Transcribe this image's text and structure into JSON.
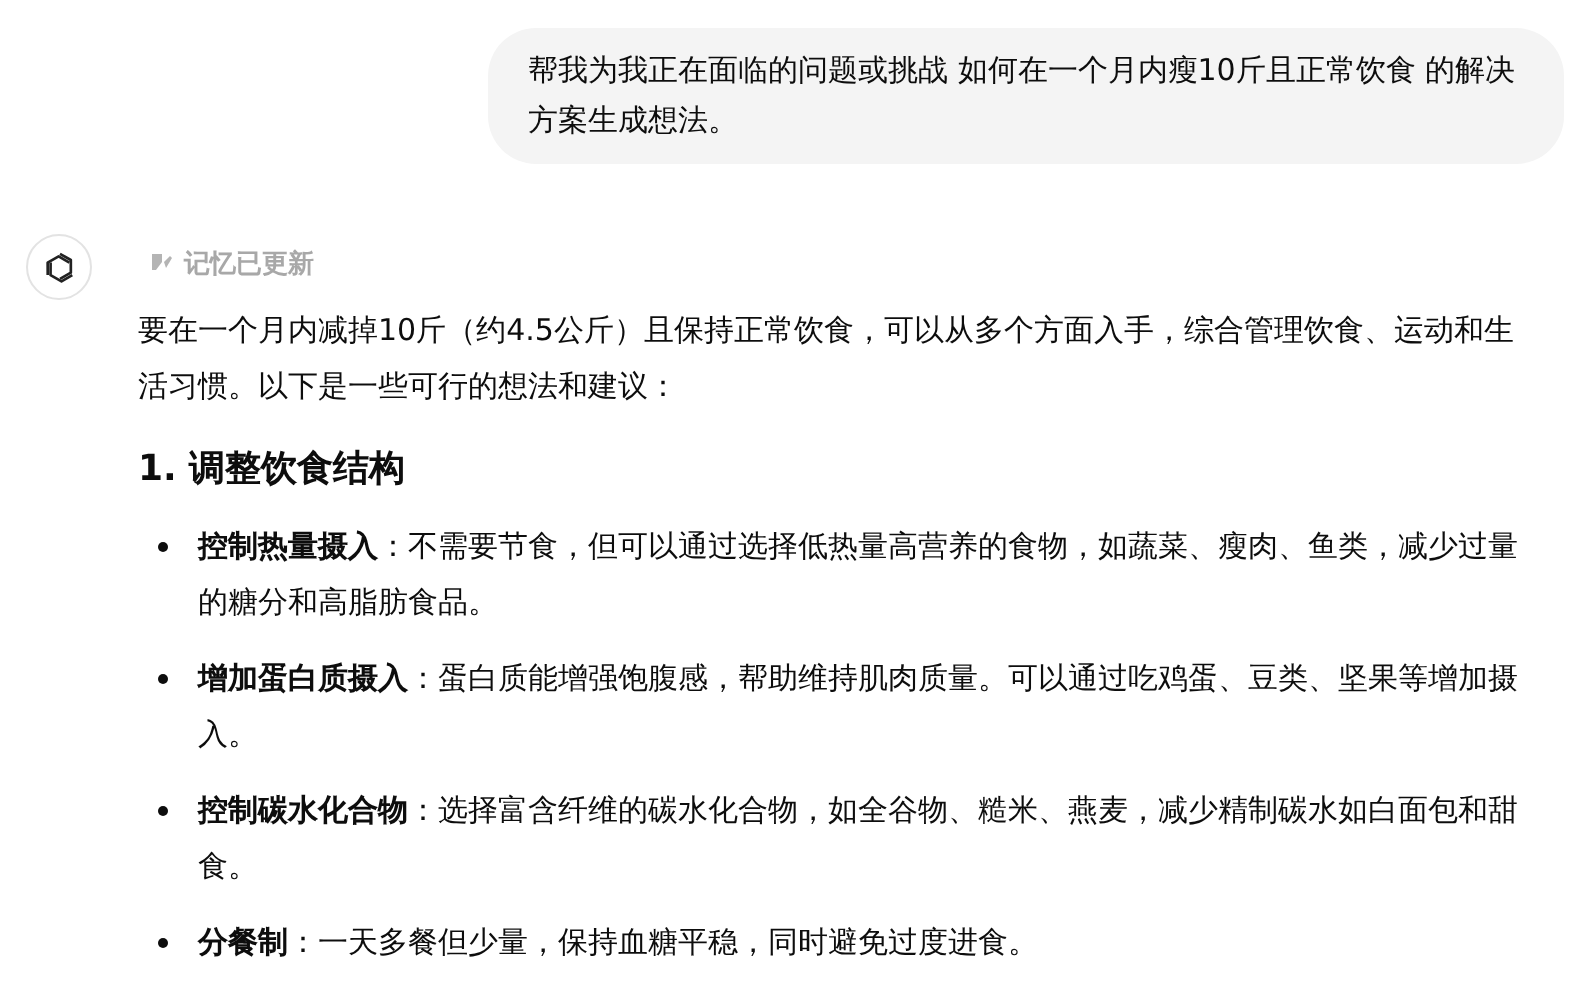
{
  "user_message": "帮我为我正在面临的问题或挑战 如何在一个月内瘦10斤且正常饮食 的解决方案生成想法。",
  "assistant": {
    "memory_notice": "记忆已更新",
    "intro": "要在一个月内减掉10斤（约4.5公斤）且保持正常饮食，可以从多个方面入手，综合管理饮食、运动和生活习惯。以下是一些可行的想法和建议：",
    "heading": "1. 调整饮食结构",
    "items": [
      "**控制热量摄入**：不需要节食，但可以通过选择低热量高营养的食物，如蔬菜、瘦肉、鱼类，减少过量的糖分和高脂肪食品。",
      "**增加蛋白质摄入**：蛋白质能增强饱腹感，帮助维持肌肉质量。可以通过吃鸡蛋、豆类、坚果等增加摄入。",
      "**控制碳水化合物**：选择富含纤维的碳水化合物，如全谷物、糙米、燕麦，减少精制碳水如白面包和甜食。",
      "**分餐制**：一天多餐但少量，保持血糖平稳，同时避免过度进食。"
    ]
  }
}
